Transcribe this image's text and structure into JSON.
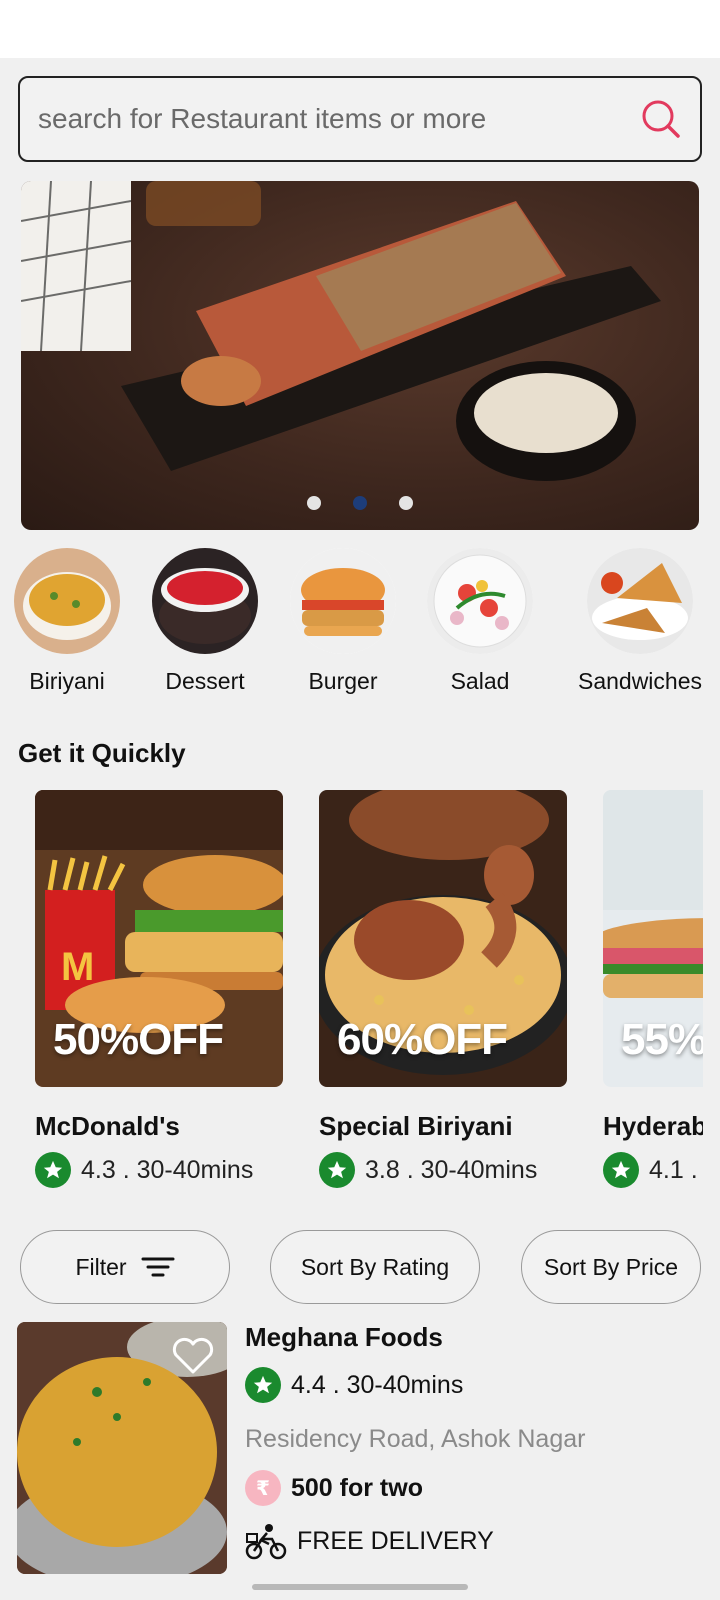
{
  "search": {
    "placeholder": "search for Restaurant items or more",
    "icon": "search-icon"
  },
  "banner": {
    "dots": 3,
    "active_dot": 1,
    "active_color": "#1d3d7a"
  },
  "categories": [
    {
      "label": "Biriyani"
    },
    {
      "label": "Dessert"
    },
    {
      "label": "Burger"
    },
    {
      "label": "Salad"
    },
    {
      "label": "Sandwiches"
    }
  ],
  "quick": {
    "title": "Get it Quickly",
    "cards": [
      {
        "offer": "50%OFF",
        "name": "McDonald's",
        "rating": "4.3 . 30-40mins"
      },
      {
        "offer": "60%OFF",
        "name": "Special Biriyani",
        "rating": "3.8 . 30-40mins"
      },
      {
        "offer": "55%",
        "name": "Hyderab",
        "rating": "4.1 ."
      }
    ]
  },
  "filters": {
    "filter": "Filter",
    "sort_rating": "Sort By Rating",
    "sort_price": "Sort By Price"
  },
  "restaurant": {
    "name": "Meghana Foods",
    "rating": "4.4 . 30-40mins",
    "address": "Residency Road, Ashok Nagar",
    "currency_symbol": "₹",
    "price": "500 for two",
    "delivery": "FREE DELIVERY"
  },
  "colors": {
    "accent": "#e23a5e",
    "rating_green": "#1a8a2e"
  }
}
